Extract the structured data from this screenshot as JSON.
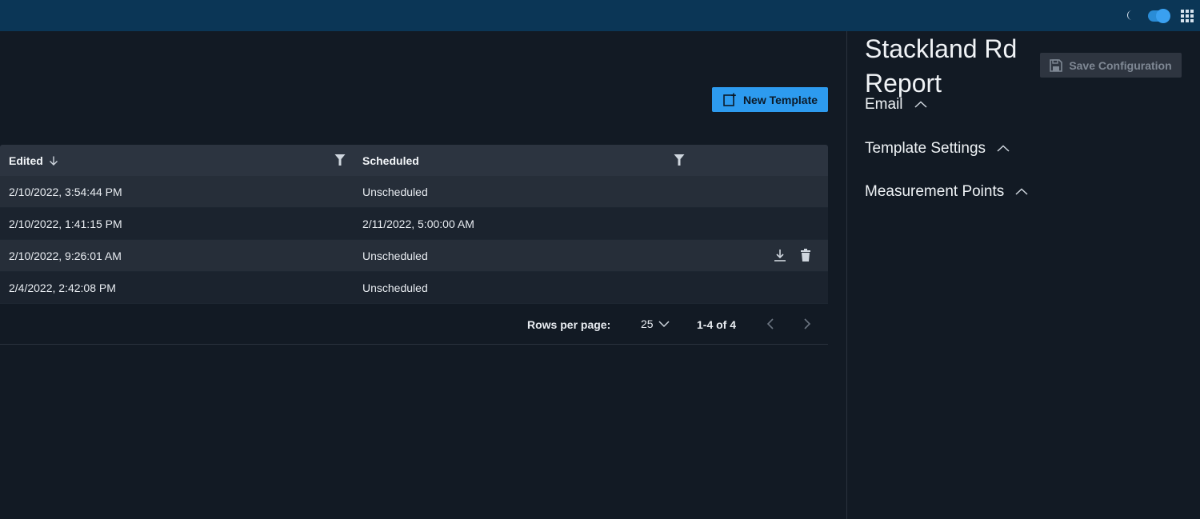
{
  "topbar": {
    "theme_icon": "moon-icon",
    "theme_toggle_on": true,
    "apps_icon": "apps-grid-icon",
    "accent": "#2d9bef",
    "bar_color": "#0b3656"
  },
  "toolbar": {
    "new_template_label": "New Template",
    "new_template_icon": "new-document-icon"
  },
  "table": {
    "columns": {
      "edited": "Edited",
      "scheduled": "Scheduled"
    },
    "sort_icon": "arrow-down-icon",
    "filter_icon": "filter-icon",
    "rows": [
      {
        "edited": "2/10/2022, 3:54:44 PM",
        "scheduled": "Unscheduled"
      },
      {
        "edited": "2/10/2022, 1:41:15 PM",
        "scheduled": "2/11/2022, 5:00:00 AM"
      },
      {
        "edited": "2/10/2022, 9:26:01 AM",
        "scheduled": "Unscheduled"
      },
      {
        "edited": "2/4/2022, 2:42:08 PM",
        "scheduled": "Unscheduled"
      }
    ]
  },
  "pagination": {
    "rows_per_page_label": "Rows per page:",
    "rows_per_page_value": "25",
    "range": "1-4 of 4"
  },
  "panel": {
    "title": "Stackland Rd Report",
    "save_label": "Save Configuration",
    "sections": {
      "email": "Email",
      "template_settings": "Template Settings",
      "measurement_points": "Measurement Points"
    }
  }
}
